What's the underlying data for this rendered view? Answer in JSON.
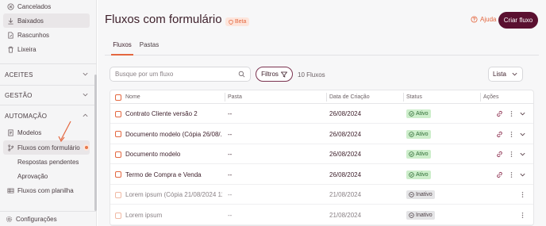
{
  "sidebar": {
    "top_items": [
      {
        "label": "Cancelados",
        "icon": "x-circle-icon"
      },
      {
        "label": "Baixados",
        "icon": "download-icon"
      },
      {
        "label": "Rascunhos",
        "icon": "file-edit-icon"
      },
      {
        "label": "Lixeira",
        "icon": "trash-icon"
      }
    ],
    "sections": {
      "aceites": "ACEITES",
      "gestao": "GESTÃO",
      "automacao": "AUTOMAÇÃO"
    },
    "automation_items": {
      "modelos": "Modelos",
      "fluxos_formulario": "Fluxos com formulário",
      "respostas_pendentes": "Respostas pendentes",
      "aprovacao": "Aprovação",
      "fluxos_planilha": "Fluxos com planilha"
    },
    "footer": "Configurações"
  },
  "header": {
    "title": "Fluxos com formulário",
    "badge": "Beta",
    "help": "Ajuda",
    "create_button": "Criar fluxo"
  },
  "tabs": [
    {
      "label": "Fluxos",
      "active": true
    },
    {
      "label": "Pastas",
      "active": false
    }
  ],
  "toolbar": {
    "search_placeholder": "Busque por um fluxo",
    "filters_label": "Filtros",
    "count_text": "10 Fluxos",
    "view_select": "Lista"
  },
  "table": {
    "columns": [
      "Nome",
      "Pasta",
      "Data de Criação",
      "Status",
      "Ações"
    ],
    "rows": [
      {
        "name": "Contrato Cliente versão 2",
        "folder": "--",
        "date": "26/08/2024",
        "status": "Ativo",
        "active": true
      },
      {
        "name": "Documento modelo (Cópia 26/08/...",
        "folder": "--",
        "date": "26/08/2024",
        "status": "Ativo",
        "active": true
      },
      {
        "name": "Documento modelo",
        "folder": "--",
        "date": "26/08/2024",
        "status": "Ativo",
        "active": true
      },
      {
        "name": "Termo de Compra e Venda",
        "folder": "--",
        "date": "26/08/2024",
        "status": "Ativo",
        "active": true
      },
      {
        "name": "Lorem ipsum (Cópia 21/08/2024 11:...",
        "folder": "--",
        "date": "21/08/2024",
        "status": "Inativo",
        "active": false
      },
      {
        "name": "Lorem ipsum",
        "folder": "--",
        "date": "21/08/2024",
        "status": "Inativo",
        "active": false
      }
    ]
  },
  "colors": {
    "accent": "#e4673f",
    "brand": "#5a1030",
    "active_status_bg": "#cdeecb",
    "inactive_status_bg": "#e4e4e6"
  }
}
